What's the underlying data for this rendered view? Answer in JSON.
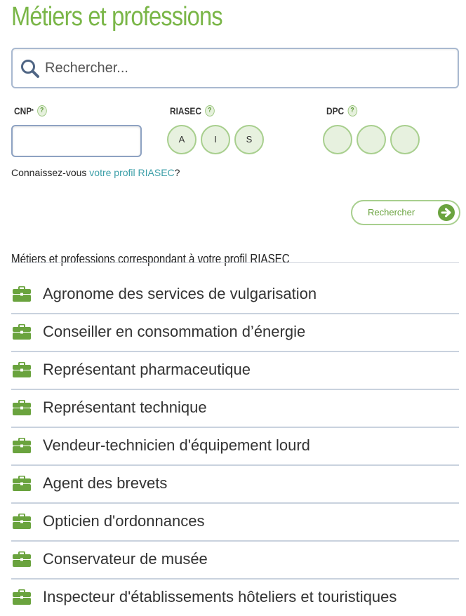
{
  "page": {
    "title": "Métiers et professions"
  },
  "search": {
    "placeholder": "Rechercher..."
  },
  "filters": {
    "cnp_label": "CNP",
    "cnp_marker": "*",
    "riasec_label": "RIASEC",
    "dpc_label": "DPC",
    "help_glyph": "?",
    "riasec_options": [
      "A",
      "I",
      "S"
    ],
    "dpc_options": [
      "",
      "",
      ""
    ]
  },
  "riasec_prompt": {
    "prefix": "Connaissez-vous ",
    "link_text": "votre profil RIASEC",
    "suffix": "?"
  },
  "submit": {
    "label": "Rechercher"
  },
  "results": {
    "heading": "Métiers et professions correspondant à votre profil RIASEC",
    "items": [
      "Agronome des services de vulgarisation",
      "Conseiller en consommation d’énergie",
      "Représentant pharmaceutique",
      "Représentant technique",
      "Vendeur-technicien d'équipement lourd",
      "Agent des brevets",
      "Opticien d'ordonnances",
      "Conservateur de musée",
      "Inspecteur d'établissements hôteliers et touristiques"
    ]
  },
  "colors": {
    "brand_green": "#7ab648",
    "link_teal": "#3c9fa8",
    "circle_fill": "#e7f1df",
    "circle_border": "#a8cf8e",
    "divider": "#c9d2de"
  },
  "icons": {
    "search": "search-icon",
    "help": "help-icon",
    "submit": "arrow-right-circle-icon",
    "result": "briefcase-icon"
  }
}
